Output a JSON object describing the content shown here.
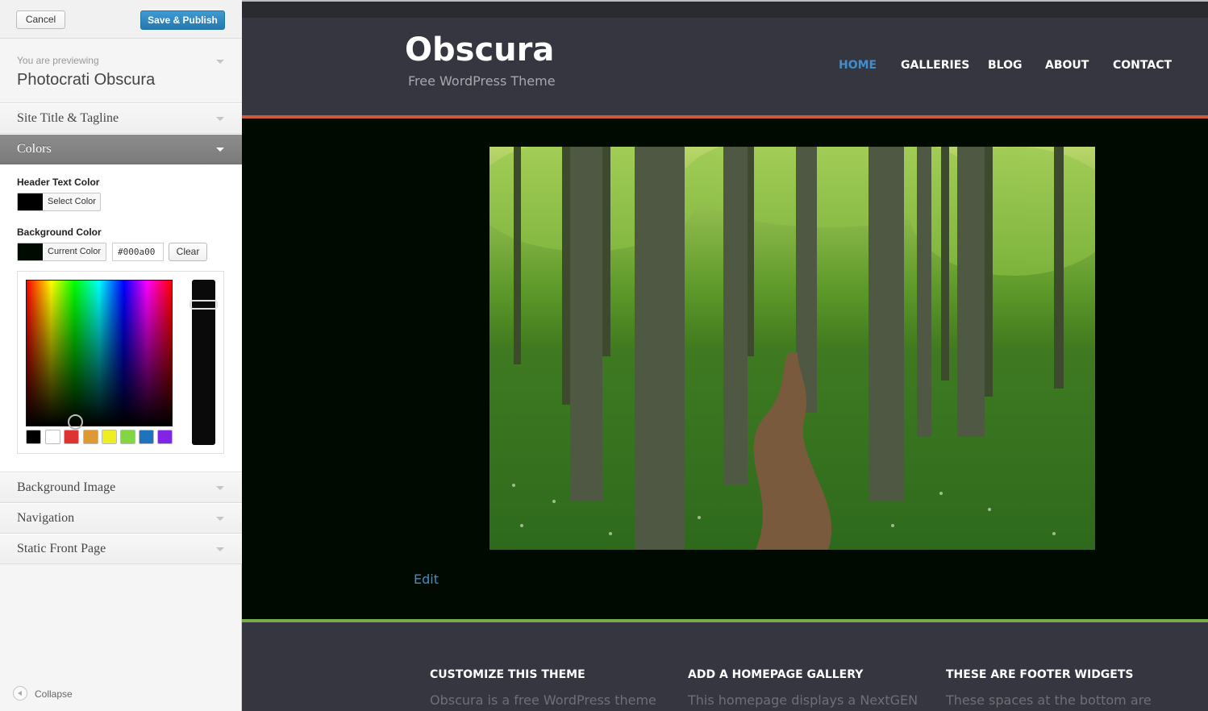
{
  "customizer": {
    "cancel_label": "Cancel",
    "save_label": "Save & Publish",
    "preview_small": "You are previewing",
    "preview_title": "Photocrati Obscura",
    "sections": {
      "site_title": "Site Title & Tagline",
      "colors": "Colors",
      "background_image": "Background Image",
      "navigation": "Navigation",
      "static_front_page": "Static Front Page"
    },
    "colors": {
      "header_text_label": "Header Text Color",
      "header_select_label": "Select Color",
      "header_color": "#000000",
      "background_label": "Background Color",
      "background_current_label": "Current Color",
      "background_hex": "#000a00",
      "clear_label": "Clear",
      "palette": [
        "#000000",
        "#ffffff",
        "#dd3333",
        "#dd9933",
        "#eeee22",
        "#81d742",
        "#1e73be",
        "#8224e3"
      ]
    },
    "collapse_label": "Collapse"
  },
  "site": {
    "title": "Obscura",
    "tagline": "Free WordPress Theme",
    "nav": [
      {
        "label": "HOME",
        "current": true
      },
      {
        "label": "GALLERIES",
        "current": false
      },
      {
        "label": "BLOG",
        "current": false
      },
      {
        "label": "ABOUT",
        "current": false
      },
      {
        "label": "CONTACT",
        "current": false
      }
    ],
    "edit_label": "Edit",
    "accent_nav": "#3e8ed0",
    "header_rule_color": "#cc5a3e",
    "footer_rule_color": "#76ac4a",
    "footer_widgets": [
      {
        "title": "CUSTOMIZE THIS THEME",
        "text": "Obscura is a free WordPress theme"
      },
      {
        "title": "ADD A HOMEPAGE GALLERY",
        "text": "This homepage displays a NextGEN"
      },
      {
        "title": "THESE ARE FOOTER WIDGETS",
        "text": "These spaces at the bottom are"
      }
    ]
  }
}
